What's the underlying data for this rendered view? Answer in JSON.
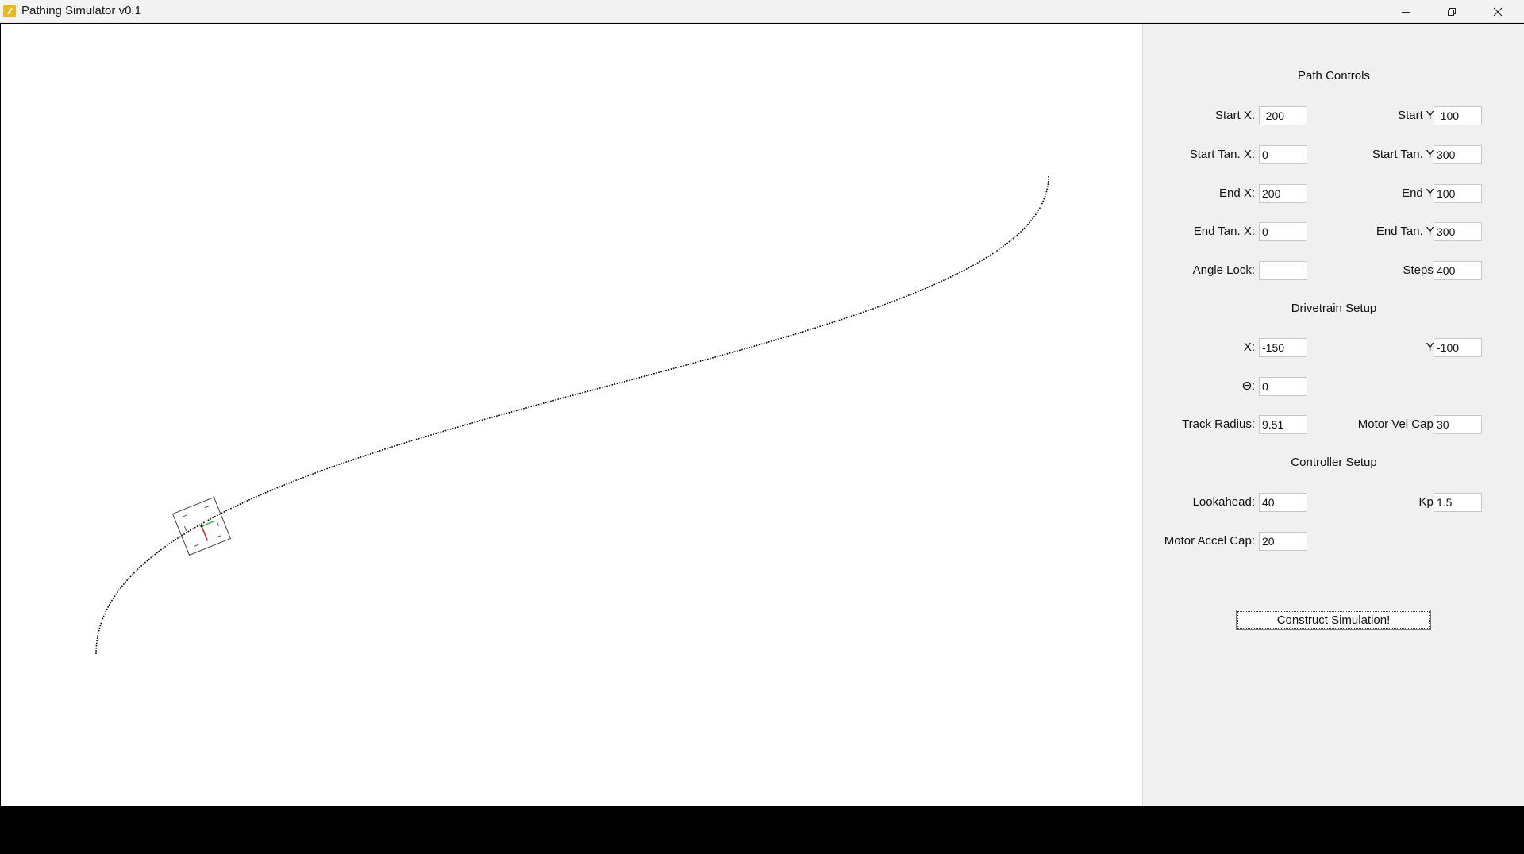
{
  "window": {
    "title": "Pathing Simulator v0.1",
    "icon": "app-icon",
    "controls": [
      "minimize-icon",
      "maximize-icon",
      "close-icon"
    ]
  },
  "canvas": {
    "background": "#ffffff",
    "path_color": "#000000",
    "path_style": "dotted",
    "robot_colors": {
      "body": "#444444",
      "heading_arrow": "#e02020",
      "side_arrow": "#30c040"
    }
  },
  "panel": {
    "sections": {
      "path_controls": "Path Controls",
      "drivetrain_setup": "Drivetrain Setup",
      "controller_setup": "Controller Setup"
    },
    "fields": {
      "start_x": {
        "label": "Start X:",
        "value": "-200"
      },
      "start_y": {
        "label": "Start Y:",
        "value": "-100"
      },
      "start_tan_x": {
        "label": "Start Tan. X:",
        "value": "0"
      },
      "start_tan_y": {
        "label": "Start Tan. Y:",
        "value": "300"
      },
      "end_x": {
        "label": "End X:",
        "value": "200"
      },
      "end_y": {
        "label": "End Y:",
        "value": "100"
      },
      "end_tan_x": {
        "label": "End Tan. X:",
        "value": "0"
      },
      "end_tan_y": {
        "label": "End Tan. Y:",
        "value": "300"
      },
      "angle_lock": {
        "label": "Angle Lock:",
        "value": ""
      },
      "steps": {
        "label": "Steps:",
        "value": "400"
      },
      "x": {
        "label": "X:",
        "value": "-150"
      },
      "y": {
        "label": "Y:",
        "value": "-100"
      },
      "theta": {
        "label": "Θ:",
        "value": "0"
      },
      "track_radius": {
        "label": "Track Radius:",
        "value": "9.51"
      },
      "motor_vel_cap": {
        "label": "Motor Vel Cap:",
        "value": "30"
      },
      "lookahead": {
        "label": "Lookahead:",
        "value": "40"
      },
      "kp": {
        "label": "Kp:",
        "value": "1.5"
      },
      "motor_accel_cap": {
        "label": "Motor Accel Cap:",
        "value": "20"
      }
    },
    "construct_button": "Construct Simulation!"
  }
}
